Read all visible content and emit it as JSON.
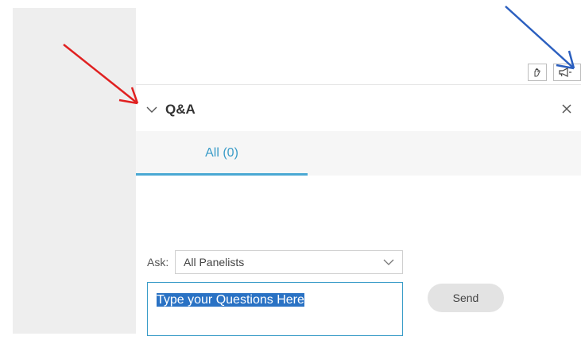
{
  "qa_panel": {
    "title": "Q&A",
    "tabs": [
      {
        "label": "All (0)",
        "active": true
      }
    ],
    "ask_label": "Ask:",
    "ask_select": {
      "selected": "All Panelists"
    },
    "question_input": {
      "value": "Type your Questions Here",
      "selected": true
    },
    "send_label": "Send"
  },
  "toolbar": {
    "icons": [
      "raise-hand-icon",
      "megaphone-icon"
    ]
  },
  "annotations": {
    "arrows": [
      {
        "color": "#e02020",
        "target": "qa-collapse"
      },
      {
        "color": "#2b5fbf",
        "target": "megaphone-button"
      }
    ]
  },
  "colors": {
    "accent": "#3a9cc8",
    "selection": "#2a72c4",
    "gutter": "#eeeeee"
  }
}
